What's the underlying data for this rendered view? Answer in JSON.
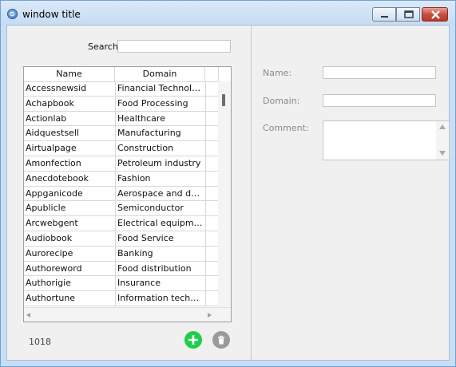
{
  "window": {
    "title": "window title",
    "controls": [
      "minimize-icon",
      "maximize-icon",
      "close-icon"
    ],
    "colors": {
      "close": "#c74e3d",
      "accent": "#1fcf4c"
    }
  },
  "search": {
    "label": "Search",
    "value": ""
  },
  "table": {
    "columns": [
      "Name",
      "Domain"
    ],
    "rows": [
      {
        "name": "Accessnewsid",
        "domain": "Financial Technology"
      },
      {
        "name": "Achapbook",
        "domain": "Food Processing"
      },
      {
        "name": "Actionlab",
        "domain": "Healthcare"
      },
      {
        "name": "Aidquestsell",
        "domain": "Manufacturing"
      },
      {
        "name": "Airtualpage",
        "domain": "Construction"
      },
      {
        "name": "Amonfection",
        "domain": "Petroleum industry"
      },
      {
        "name": "Anecdotebook",
        "domain": "Fashion"
      },
      {
        "name": "Appganicode",
        "domain": "Aerospace and defe..."
      },
      {
        "name": "Apublicle",
        "domain": "Semiconductor"
      },
      {
        "name": "Arcwebgent",
        "domain": "Electrical equipment"
      },
      {
        "name": "Audiobook",
        "domain": "Food Service"
      },
      {
        "name": "Aurorecipe",
        "domain": "Banking"
      },
      {
        "name": "Authoreword",
        "domain": "Food distribution"
      },
      {
        "name": "Authorigie",
        "domain": "Insurance"
      },
      {
        "name": "Authortune",
        "domain": "Information technol..."
      }
    ]
  },
  "footer": {
    "count": "1018",
    "add_icon": "plus-icon",
    "delete_icon": "trash-icon"
  },
  "form": {
    "name_label": "Name:",
    "name_value": "",
    "domain_label": "Domain:",
    "domain_value": "",
    "comment_label": "Comment:",
    "comment_value": ""
  }
}
